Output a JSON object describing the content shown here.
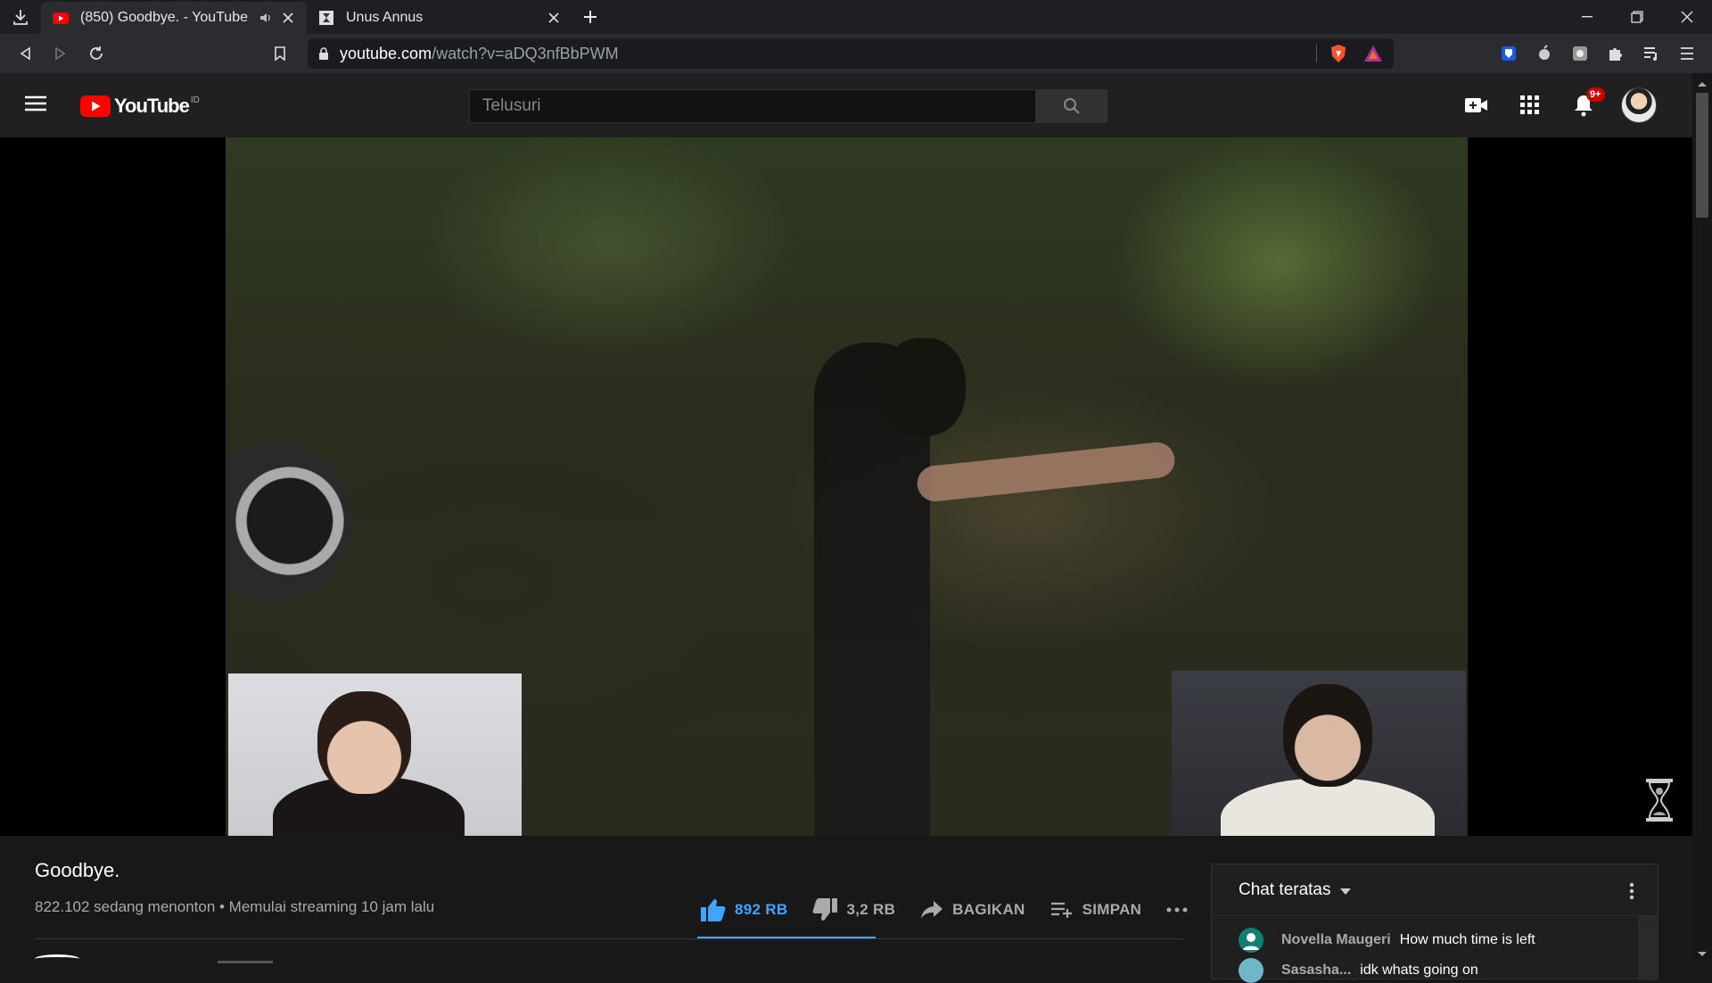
{
  "browser": {
    "tabs": [
      {
        "title": "(850) Goodbye. - YouTube",
        "active": true
      },
      {
        "title": "Unus Annus",
        "active": false
      }
    ],
    "url": {
      "host": "youtube.com",
      "path": "/watch?v=aDQ3nfBbPWM"
    }
  },
  "youtube": {
    "logo_text": "YouTube",
    "region": "ID",
    "search_placeholder": "Telusuri",
    "notifications_badge": "9+"
  },
  "video": {
    "title": "Goodbye.",
    "meta": "822.102 sedang menonton • Memulai streaming 10 jam lalu",
    "likes": "892 RB",
    "dislikes": "3,2 RB",
    "share_label": "BAGIKAN",
    "save_label": "SIMPAN"
  },
  "chat": {
    "header": "Chat teratas",
    "messages": [
      {
        "author": "Novella Maugeri",
        "text": "How much time is left"
      },
      {
        "author": "Sasasha...",
        "text": "idk whats going on"
      }
    ]
  },
  "colors": {
    "accent": "#3ea6ff",
    "yt_red": "#ff0000",
    "badge": "#cc0000"
  }
}
